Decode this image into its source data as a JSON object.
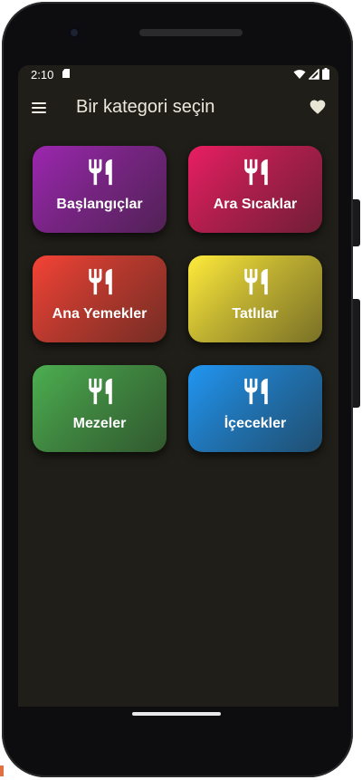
{
  "status_bar": {
    "time": "2:10"
  },
  "app_bar": {
    "title": "Bir kategori seçin",
    "menu_icon": "menu-icon",
    "favorite_icon": "heart-icon"
  },
  "categories": [
    {
      "label": "Başlangıçlar",
      "icon": "restaurant-icon",
      "color": "#9c27b0"
    },
    {
      "label": "Ara Sıcaklar",
      "icon": "restaurant-icon",
      "color": "#e91e63"
    },
    {
      "label": "Ana Yemekler",
      "icon": "restaurant-icon",
      "color": "#f44336"
    },
    {
      "label": "Tatlılar",
      "icon": "restaurant-icon",
      "color": "#ffeb3b"
    },
    {
      "label": "Mezeler",
      "icon": "restaurant-icon",
      "color": "#4caf50"
    },
    {
      "label": "İçecekler",
      "icon": "restaurant-icon",
      "color": "#2196f3"
    }
  ]
}
